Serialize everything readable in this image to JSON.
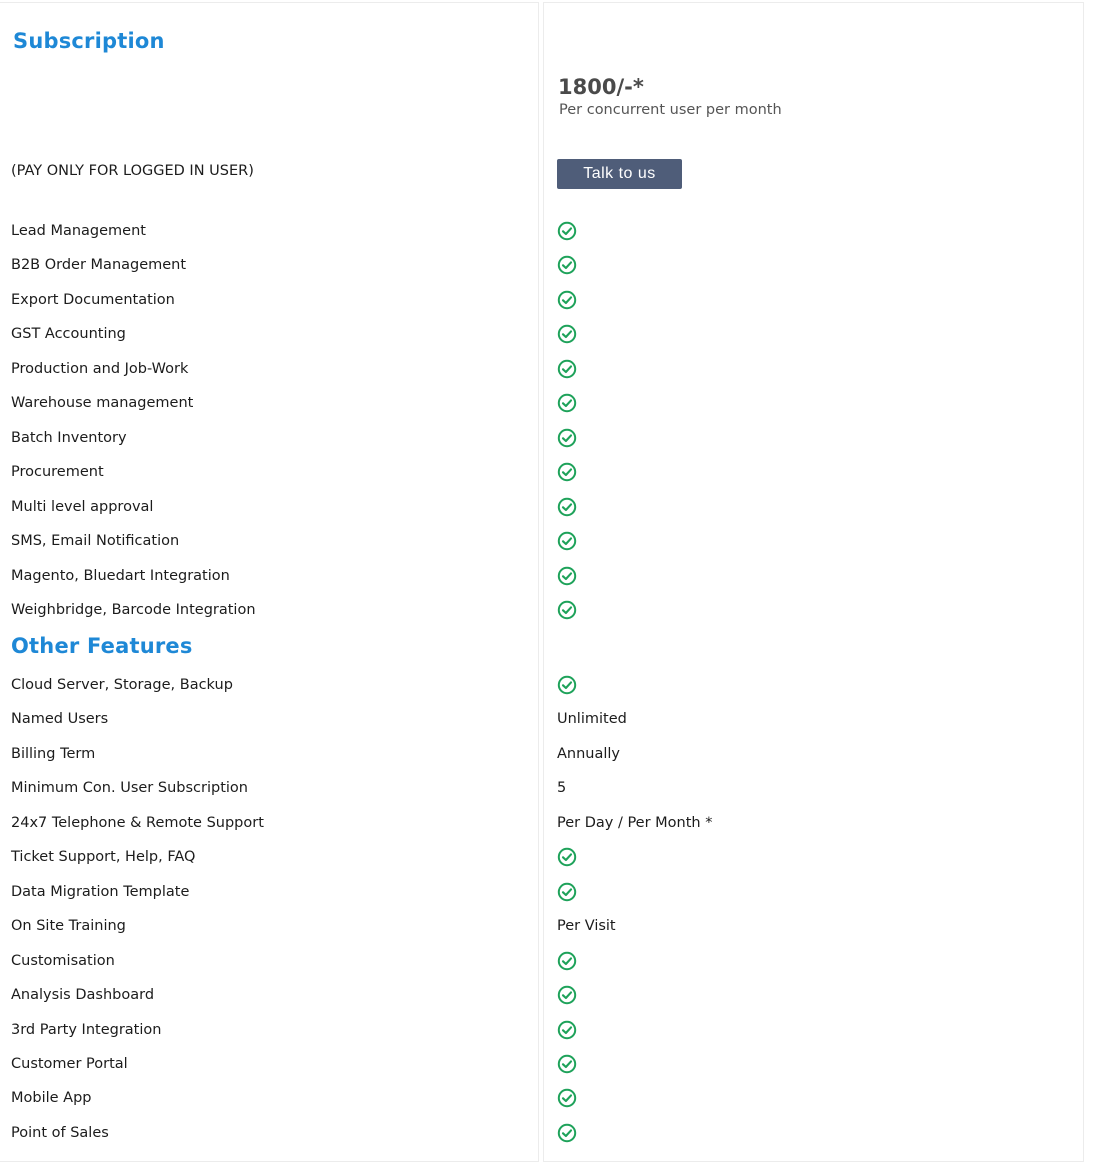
{
  "subscription": {
    "title": "Subscription",
    "note": "(PAY ONLY FOR LOGGED IN USER)",
    "price": "1800/-*",
    "price_sub": "Per concurrent user per month",
    "cta_label": "Talk to us"
  },
  "core_features": [
    {
      "label": "Lead Management",
      "value": "check-icon"
    },
    {
      "label": "B2B Order Management",
      "value": "check-icon"
    },
    {
      "label": "Export Documentation",
      "value": "check-icon"
    },
    {
      "label": "GST Accounting",
      "value": "check-icon"
    },
    {
      "label": "Production and Job-Work",
      "value": "check-icon"
    },
    {
      "label": "Warehouse management",
      "value": "check-icon"
    },
    {
      "label": "Batch Inventory",
      "value": "check-icon"
    },
    {
      "label": "Procurement",
      "value": "check-icon"
    },
    {
      "label": "Multi level approval",
      "value": "check-icon"
    },
    {
      "label": "SMS, Email Notification",
      "value": "check-icon"
    },
    {
      "label": "Magento, Bluedart Integration",
      "value": "check-icon"
    },
    {
      "label": "Weighbridge, Barcode Integration",
      "value": "check-icon"
    }
  ],
  "other_features_title": "Other Features",
  "other_features": [
    {
      "label": "Cloud Server, Storage, Backup",
      "value": "check-icon"
    },
    {
      "label": "Named Users",
      "text": "Unlimited"
    },
    {
      "label": "Billing Term",
      "text": "Annually"
    },
    {
      "label": "Minimum Con. User Subscription",
      "text": "5"
    },
    {
      "label": "24x7 Telephone & Remote Support",
      "text": "Per Day / Per Month *"
    },
    {
      "label": "Ticket Support, Help, FAQ",
      "value": "check-icon"
    },
    {
      "label": "Data Migration Template",
      "value": "check-icon"
    },
    {
      "label": "On Site Training",
      "text": "Per Visit"
    },
    {
      "label": "Customisation",
      "value": "check-icon"
    },
    {
      "label": "Analysis Dashboard",
      "value": "check-icon"
    },
    {
      "label": "3rd Party Integration",
      "value": "check-icon"
    },
    {
      "label": "Customer Portal",
      "value": "check-icon"
    },
    {
      "label": "Mobile App",
      "value": "check-icon"
    },
    {
      "label": "Point of Sales",
      "value": "check-icon"
    }
  ],
  "colors": {
    "heading": "#1e88d6",
    "check": "#1ea25a",
    "button": "#4f5d79"
  }
}
